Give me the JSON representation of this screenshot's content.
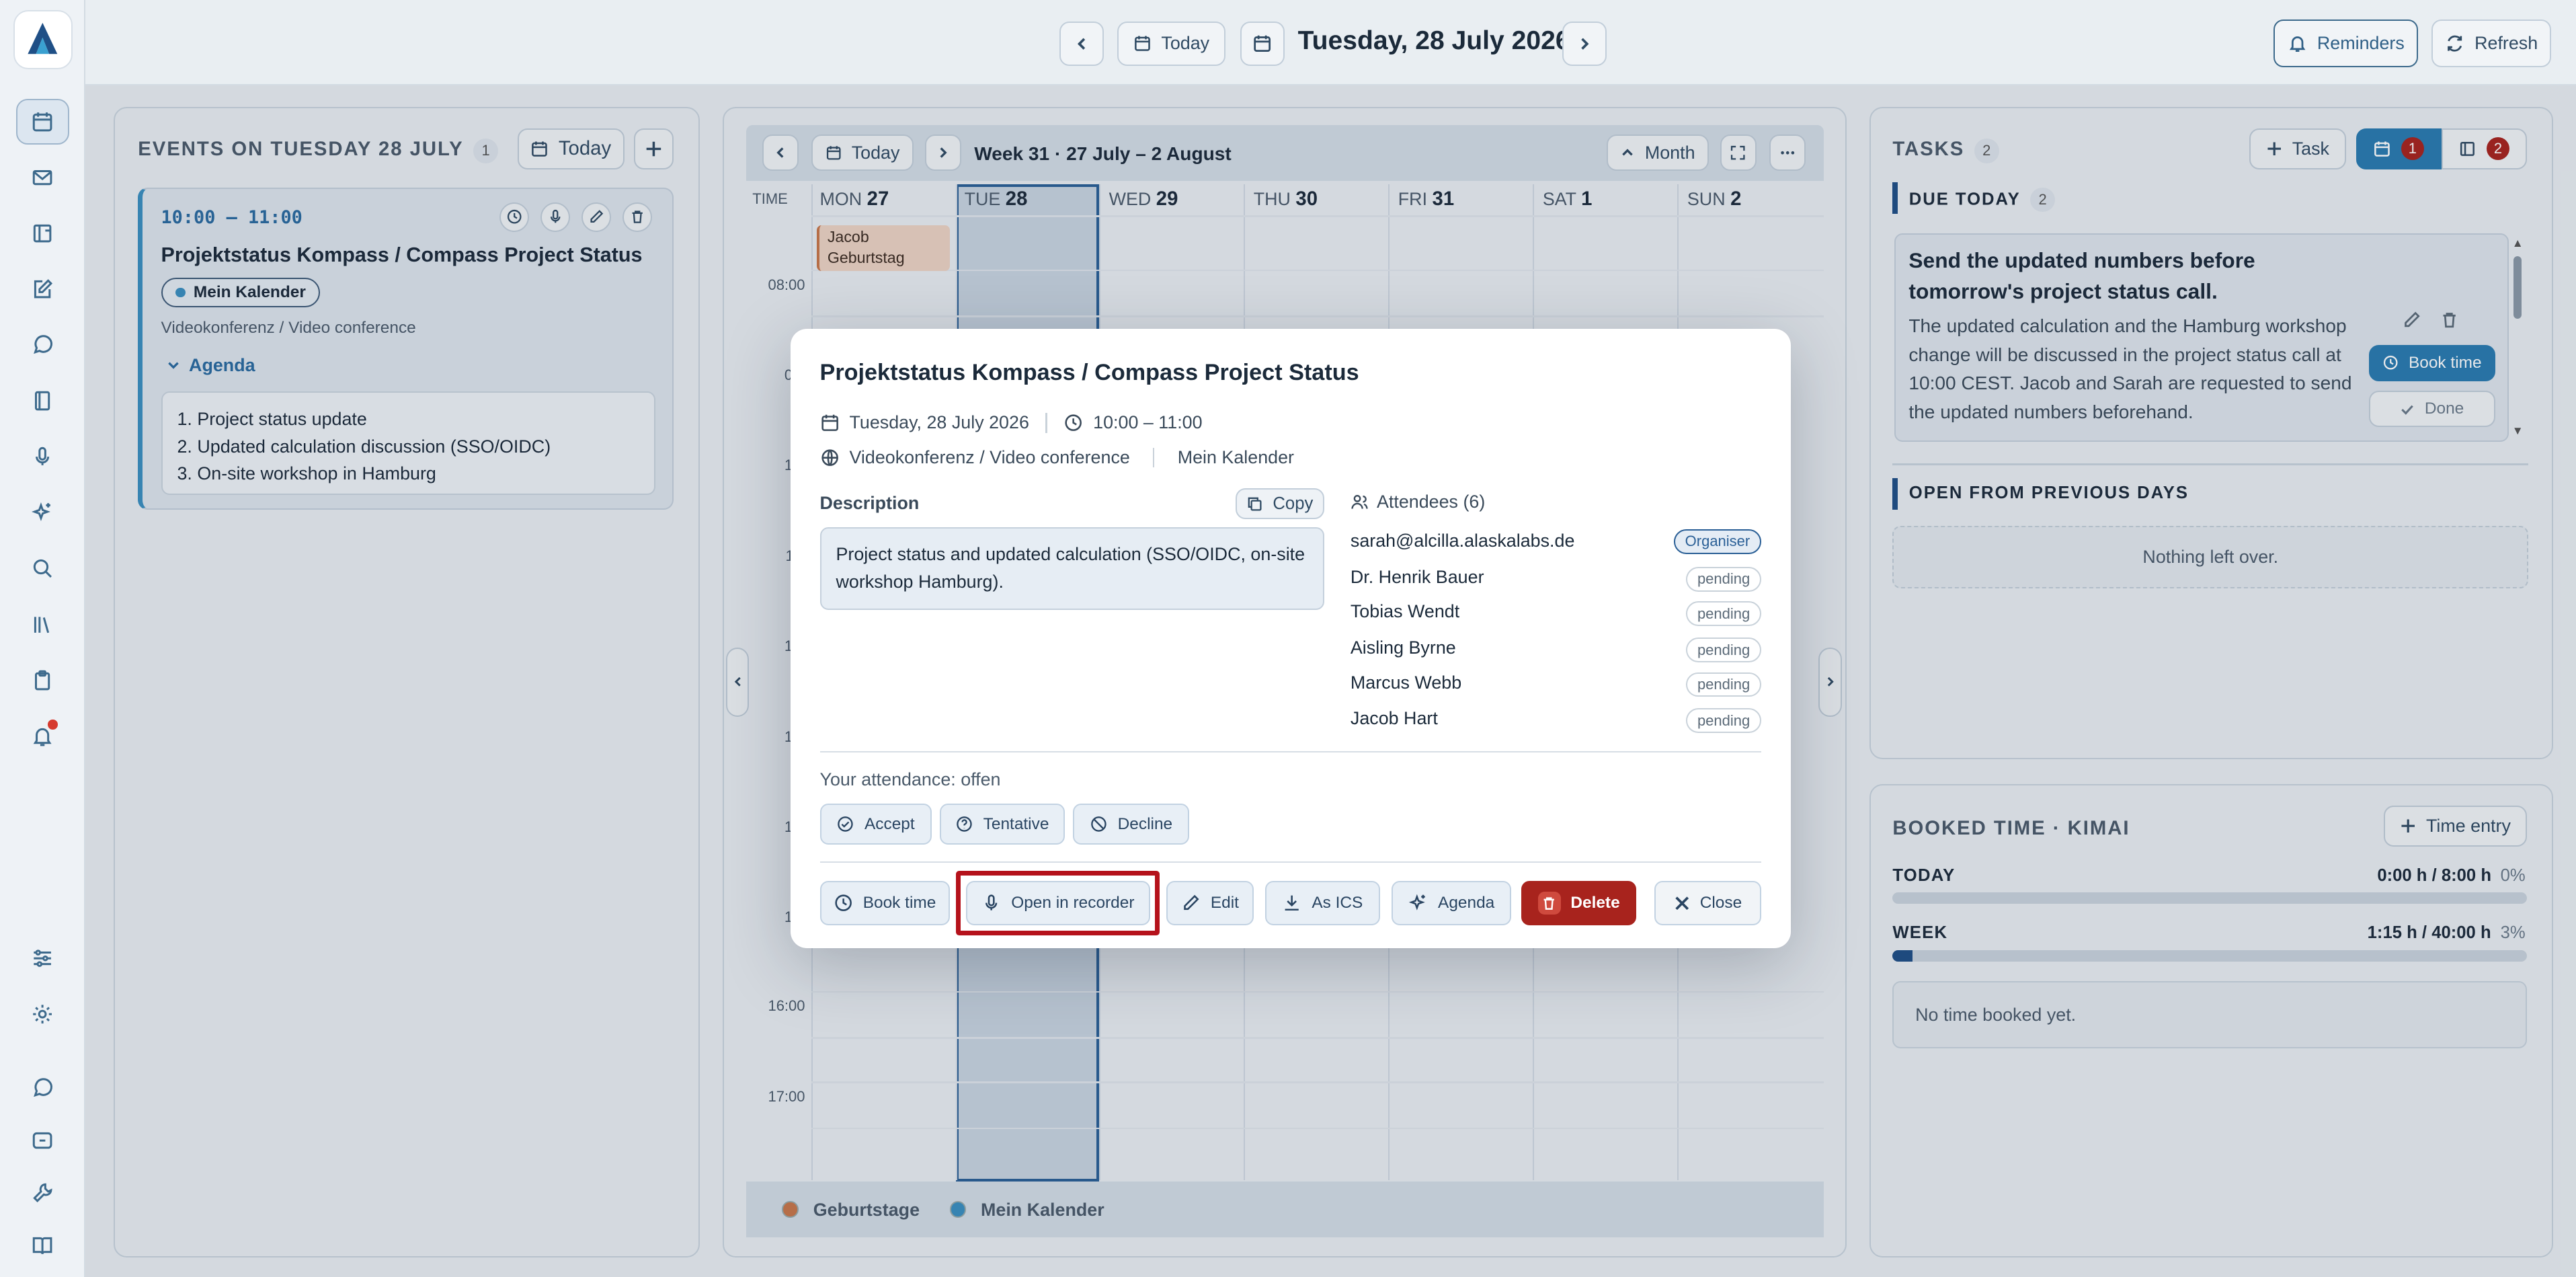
{
  "topbar": {
    "today_label": "Today",
    "date_title": "Tuesday, 28 July 2026",
    "reminders_label": "Reminders",
    "refresh_label": "Refresh"
  },
  "events_panel": {
    "title": "EVENTS ON TUESDAY 28 JULY",
    "count": "1",
    "today_label": "Today",
    "event": {
      "time": "10:00 – 11:00",
      "title": "Projektstatus Kompass / Compass Project Status",
      "calendar": "Mein Kalender",
      "location": "Videokonferenz / Video conference",
      "agenda_label": "Agenda",
      "agenda_items": [
        "1. Project status update",
        "2. Updated calculation discussion (SSO/OIDC)",
        "3. On-site workshop in Hamburg"
      ]
    }
  },
  "calendar": {
    "today_label": "Today",
    "week_title": "Week 31 · 27 July – 2 August",
    "month_label": "Month",
    "time_header": "TIME",
    "days": [
      {
        "name": "MON",
        "num": "27"
      },
      {
        "name": "TUE",
        "num": "28"
      },
      {
        "name": "WED",
        "num": "29"
      },
      {
        "name": "THU",
        "num": "30"
      },
      {
        "name": "FRI",
        "num": "31"
      },
      {
        "name": "SAT",
        "num": "1"
      },
      {
        "name": "SUN",
        "num": "2"
      }
    ],
    "times": [
      "08:00",
      "09:",
      "10:",
      "11:",
      "12:",
      "13:",
      "14:",
      "15:",
      "16:00",
      "17:00"
    ],
    "birthday_event": "Jacob Geburtstag",
    "legend": [
      {
        "label": "Geburtstage",
        "color": "#c8764a"
      },
      {
        "label": "Mein Kalender",
        "color": "#3a8fc0"
      }
    ]
  },
  "tasks_panel": {
    "title": "TASKS",
    "count": "2",
    "task_btn": "Task",
    "badge_cal": "1",
    "badge_list": "2",
    "due_today_label": "DUE TODAY",
    "due_today_count": "2",
    "task": {
      "title": "Send the updated numbers before tomorrow's project status call.",
      "body": "The updated calculation and the Hamburg workshop change will be discussed in the project status call at 10:00 CEST. Jacob and Sarah are requested to send the updated numbers beforehand.",
      "book_time": "Book time",
      "done": "Done"
    },
    "open_prev_label": "OPEN FROM PREVIOUS DAYS",
    "nothing_left": "Nothing left over."
  },
  "booked_panel": {
    "title": "BOOKED TIME · KIMAI",
    "time_entry": "Time entry",
    "today_label": "TODAY",
    "today_value": "0:00 h / 8:00 h",
    "today_pct": "0%",
    "today_fill": 0,
    "week_label": "WEEK",
    "week_value": "1:15 h / 40:00 h",
    "week_pct": "3%",
    "week_fill": 0.03,
    "none_booked": "No time booked yet."
  },
  "modal": {
    "title": "Projektstatus Kompass / Compass Project Status",
    "date": "Tuesday, 28 July 2026",
    "time": "10:00 – 11:00",
    "location": "Videokonferenz / Video conference",
    "calendar": "Mein Kalender",
    "description_label": "Description",
    "copy_label": "Copy",
    "description": "Project status and updated calculation (SSO/OIDC, on-site workshop Hamburg).",
    "attendees_label": "Attendees (6)",
    "attendees": [
      {
        "name": "sarah@alcilla.alaskalabs.de",
        "status": "Organiser"
      },
      {
        "name": "Dr. Henrik Bauer",
        "status": "pending"
      },
      {
        "name": "Tobias Wendt",
        "status": "pending"
      },
      {
        "name": "Aisling Byrne",
        "status": "pending"
      },
      {
        "name": "Marcus Webb",
        "status": "pending"
      },
      {
        "name": "Jacob Hart",
        "status": "pending"
      }
    ],
    "attendance": "Your attendance: offen",
    "accept": "Accept",
    "tentative": "Tentative",
    "decline": "Decline",
    "book_time": "Book time",
    "open_recorder": "Open in recorder",
    "edit": "Edit",
    "as_ics": "As ICS",
    "agenda": "Agenda",
    "delete": "Delete",
    "close": "Close",
    "highlight_color": "#b5121b"
  }
}
